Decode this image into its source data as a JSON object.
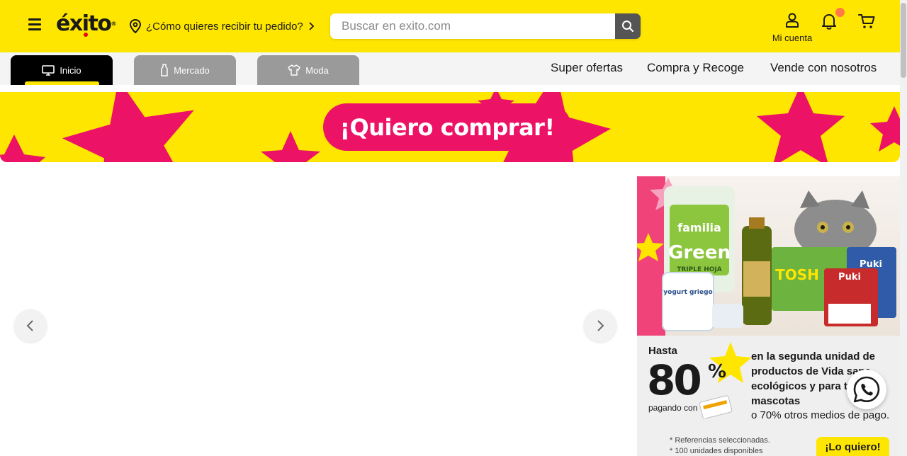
{
  "header": {
    "logo_text": "éxito",
    "logo_reg": "®",
    "delivery_prompt": "¿Cómo quieres recibir tu pedido?",
    "search_placeholder": "Buscar en exito.com",
    "account_label": "Mi cuenta",
    "colors": {
      "brand_yellow": "#ffe600",
      "notification_dot": "#ff7a45"
    }
  },
  "tabs": [
    {
      "label": "Inicio",
      "icon": "monitor-icon",
      "active": true
    },
    {
      "label": "Mercado",
      "icon": "bottle-icon",
      "active": false
    },
    {
      "label": "Moda",
      "icon": "shirt-icon",
      "active": false
    }
  ],
  "nav_links": [
    "Super ofertas",
    "Compra y Recoge",
    "Vende con nosotros"
  ],
  "promo_banner": {
    "text": "¡Quiero comprar!",
    "colors": {
      "pill": "#ec1266",
      "stars": "#ec1266"
    }
  },
  "carousel": {
    "prev_icon": "chevron-left-icon",
    "next_icon": "chevron-right-icon"
  },
  "side_ad": {
    "products": {
      "paper": "familia",
      "paper_line": "Green",
      "paper_sub": "TRIPLE HOJA",
      "oil": "TOSH",
      "pet_food": "Puki",
      "yogurt": "yogurt griego"
    },
    "hasta": "Hasta",
    "discount": "80",
    "percent_sign": "%",
    "pagando_con": "pagando con",
    "description": "en la segunda unidad de productos de Vida sana, ecológicos y para tus mascotas",
    "otros": "o 70% otros medios de pago.",
    "refs": [
      "* Referencias seleccionadas.",
      "* 100 unidades disponibles"
    ],
    "cta": "¡Lo quiero!"
  },
  "whatsapp": {
    "icon": "whatsapp-icon"
  }
}
